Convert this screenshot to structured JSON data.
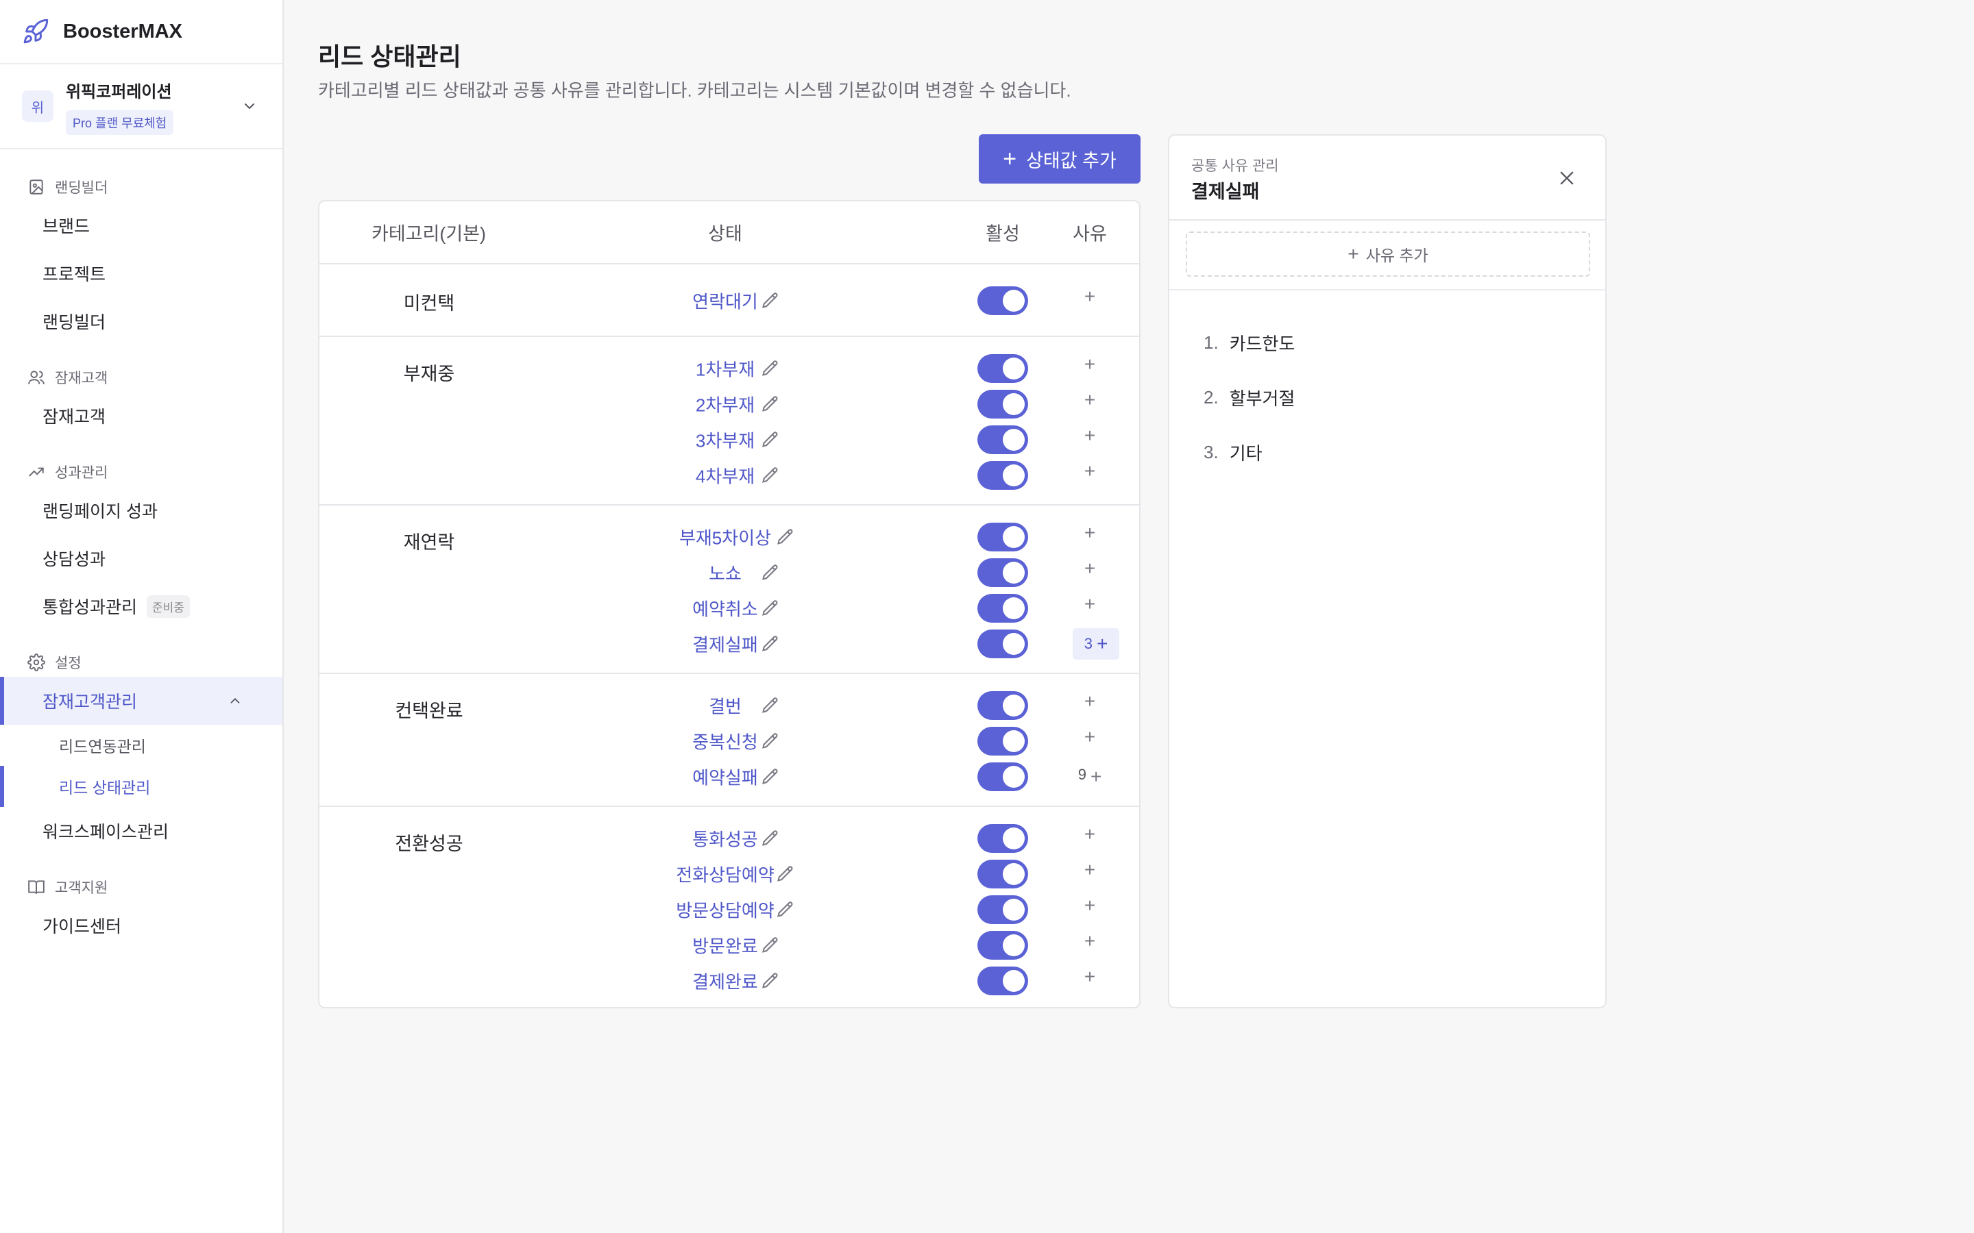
{
  "app": {
    "name": "BoosterMAX"
  },
  "workspace": {
    "avatar": "위",
    "name": "위픽코퍼레이션",
    "plan_badge": "Pro 플랜 무료체험"
  },
  "sidebar": {
    "sections": [
      {
        "label": "랜딩빌더",
        "icon": "landing-page-icon",
        "items": [
          "브랜드",
          "프로젝트",
          "랜딩빌더"
        ]
      },
      {
        "label": "잠재고객",
        "icon": "users-icon",
        "items": [
          "잠재고객"
        ]
      },
      {
        "label": "성과관리",
        "icon": "trending-up-icon",
        "items": [
          "랜딩페이지 성과",
          "상담성과",
          "통합성과관리"
        ],
        "tag": "준비중"
      },
      {
        "label": "설정",
        "icon": "gear-icon",
        "active_item": "잠재고객관리",
        "sub_items": [
          "리드연동관리",
          "리드 상태관리"
        ],
        "item_after": "워크스페이스관리"
      },
      {
        "label": "고객지원",
        "icon": "book-icon",
        "items": [
          "가이드센터"
        ]
      }
    ]
  },
  "page": {
    "title": "리드 상태관리",
    "description": "카테고리별 리드 상태값과 공통 사유를 관리합니다. 카테고리는 시스템 기본값이며 변경할 수 없습니다.",
    "add_status_label": "상태값 추가"
  },
  "table": {
    "headers": {
      "category": "카테고리(기본)",
      "status": "상태",
      "active": "활성",
      "reason": "사유"
    },
    "groups": [
      {
        "category": "미컨택",
        "rows": [
          {
            "status": "연락대기",
            "active": true,
            "reason_count": ""
          }
        ]
      },
      {
        "category": "부재중",
        "rows": [
          {
            "status": "1차부재",
            "active": true,
            "reason_count": ""
          },
          {
            "status": "2차부재",
            "active": true,
            "reason_count": ""
          },
          {
            "status": "3차부재",
            "active": true,
            "reason_count": ""
          },
          {
            "status": "4차부재",
            "active": true,
            "reason_count": ""
          }
        ]
      },
      {
        "category": "재연락",
        "rows": [
          {
            "status": "부재5차이상",
            "active": true,
            "reason_count": ""
          },
          {
            "status": "노쇼",
            "active": true,
            "reason_count": ""
          },
          {
            "status": "예약취소",
            "active": true,
            "reason_count": ""
          },
          {
            "status": "결제실패",
            "active": true,
            "reason_count": "3",
            "selected": true
          }
        ]
      },
      {
        "category": "컨택완료",
        "rows": [
          {
            "status": "결번",
            "active": true,
            "reason_count": ""
          },
          {
            "status": "중복신청",
            "active": true,
            "reason_count": ""
          },
          {
            "status": "예약실패",
            "active": true,
            "reason_count": "9"
          }
        ]
      },
      {
        "category": "전환성공",
        "rows": [
          {
            "status": "통화성공",
            "active": true,
            "reason_count": ""
          },
          {
            "status": "전화상담예약",
            "active": true,
            "reason_count": ""
          },
          {
            "status": "방문상담예약",
            "active": true,
            "reason_count": ""
          },
          {
            "status": "방문완료",
            "active": true,
            "reason_count": ""
          },
          {
            "status": "결제완료",
            "active": true,
            "reason_count": ""
          }
        ]
      }
    ]
  },
  "panel": {
    "subtitle": "공통 사유 관리",
    "title": "결제실패",
    "add_reason_label": "사유 추가",
    "reasons": [
      {
        "num": "1.",
        "text": "카드한도"
      },
      {
        "num": "2.",
        "text": "할부거절"
      },
      {
        "num": "3.",
        "text": "기타"
      }
    ]
  },
  "colors": {
    "accent": "#5a62d6",
    "accent_text": "#4f57c9",
    "accent_bg": "#eef0fb"
  }
}
